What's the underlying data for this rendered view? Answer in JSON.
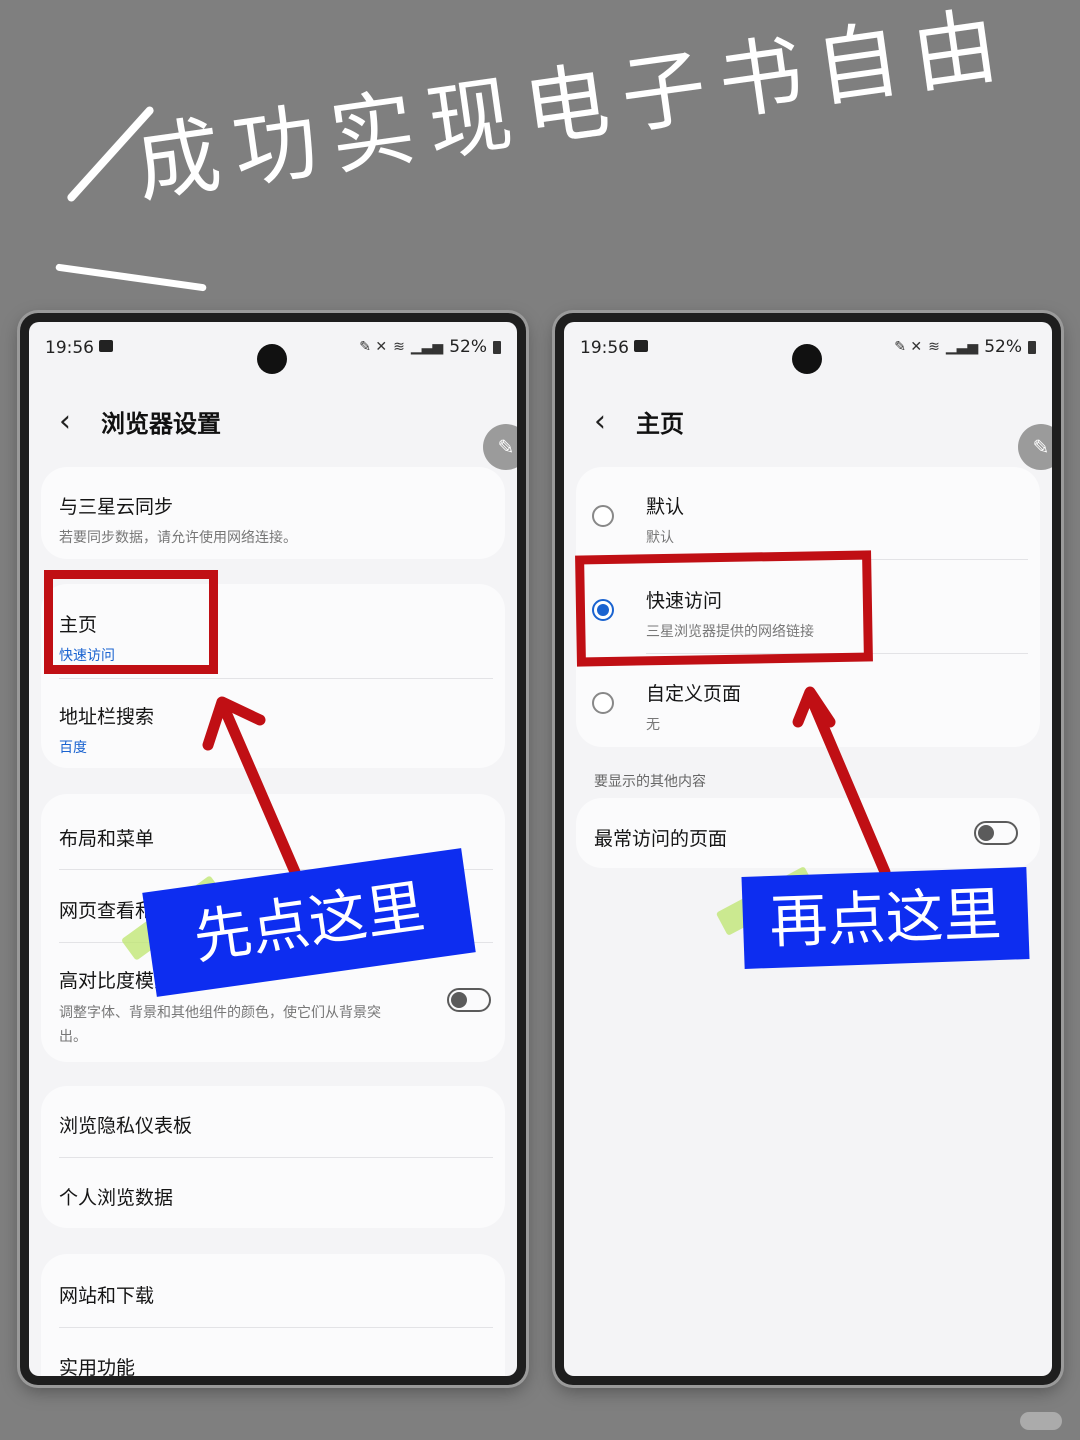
{
  "headline": "成功实现电子书自由",
  "colors": {
    "background": "#7f7f7f",
    "highlight_red": "#c00f14",
    "callout_blue": "#0d2df0",
    "accent_blue": "#1a63d0"
  },
  "left_phone": {
    "status": {
      "time": "19:56",
      "battery": "52%"
    },
    "title": "浏览器设置",
    "items": [
      {
        "title": "与三星云同步",
        "subtitle": "若要同步数据，请允许使用网络连接。"
      },
      {
        "title": "主页",
        "subtitle": "快速访问"
      },
      {
        "title": "地址栏搜索",
        "subtitle": "百度"
      },
      {
        "title": "布局和菜单"
      },
      {
        "title": "网页查看和滚动"
      },
      {
        "title": "高对比度模式",
        "subtitle": "调整字体、背景和其他组件的颜色，使它们从背景突出。"
      },
      {
        "title": "浏览隐私仪表板"
      },
      {
        "title": "个人浏览数据"
      },
      {
        "title": "网站和下载"
      },
      {
        "title": "实用功能"
      }
    ],
    "callout": "先点这里"
  },
  "right_phone": {
    "status": {
      "time": "19:56",
      "battery": "52%"
    },
    "title": "主页",
    "options": [
      {
        "title": "默认",
        "subtitle": "默认",
        "selected": false
      },
      {
        "title": "快速访问",
        "subtitle": "三星浏览器提供的网络链接",
        "selected": true
      },
      {
        "title": "自定义页面",
        "subtitle": "无",
        "selected": false
      }
    ],
    "section_label": "要显示的其他内容",
    "toggle_item": "最常访问的页面",
    "callout": "再点这里"
  },
  "icons": [
    "back-chevron-icon",
    "edit-pencil-icon",
    "gallery-icon",
    "signal-icon",
    "wifi-icon",
    "mute-icon",
    "battery-icon"
  ]
}
